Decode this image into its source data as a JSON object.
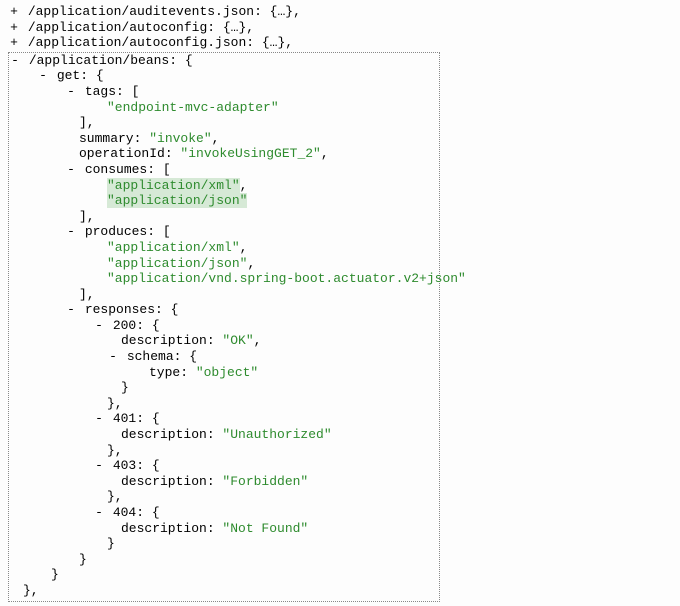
{
  "collapsed": [
    {
      "toggle": "+",
      "path": "/application/auditevents.json",
      "suffix": ": {…},"
    },
    {
      "toggle": "+",
      "path": "/application/autoconfig",
      "suffix": ": {…},"
    },
    {
      "toggle": "+",
      "path": "/application/autoconfig.json",
      "suffix": ": {…},"
    }
  ],
  "beans": {
    "toggle": "-",
    "path": "/application/beans",
    "open": ": {",
    "get": {
      "toggle": "-",
      "label": "get: {",
      "tags": {
        "toggle": "-",
        "label": "tags: [",
        "values": [
          "\"endpoint-mvc-adapter\""
        ],
        "close": "],"
      },
      "summary": {
        "key": "summary: ",
        "value": "\"invoke\"",
        "comma": ","
      },
      "operationId": {
        "key": "operationId: ",
        "value": "\"invokeUsingGET_2\"",
        "comma": ","
      },
      "consumes": {
        "toggle": "-",
        "label": "consumes: [",
        "values": [
          "\"application/xml\"",
          "\"application/json\""
        ],
        "close": "],"
      },
      "produces": {
        "toggle": "-",
        "label": "produces: [",
        "values": [
          "\"application/xml\"",
          "\"application/json\"",
          "\"application/vnd.spring-boot.actuator.v2+json\""
        ],
        "close": "],"
      },
      "responses": {
        "toggle": "-",
        "label": "responses: {",
        "r200": {
          "toggle": "-",
          "label": "200: {",
          "description": {
            "key": "description: ",
            "value": "\"OK\"",
            "comma": ","
          },
          "schema": {
            "toggle": "-",
            "label": "schema: {",
            "type": {
              "key": "type: ",
              "value": "\"object\""
            },
            "close": "}"
          },
          "close": "},"
        },
        "r401": {
          "toggle": "-",
          "label": "401: {",
          "description": {
            "key": "description: ",
            "value": "\"Unauthorized\""
          },
          "close": "},"
        },
        "r403": {
          "toggle": "-",
          "label": "403: {",
          "description": {
            "key": "description: ",
            "value": "\"Forbidden\""
          },
          "close": "},"
        },
        "r404": {
          "toggle": "-",
          "label": "404: {",
          "description": {
            "key": "description: ",
            "value": "\"Not Found\""
          },
          "close": "}"
        },
        "close": "}"
      },
      "close": "}"
    },
    "close": "},"
  }
}
